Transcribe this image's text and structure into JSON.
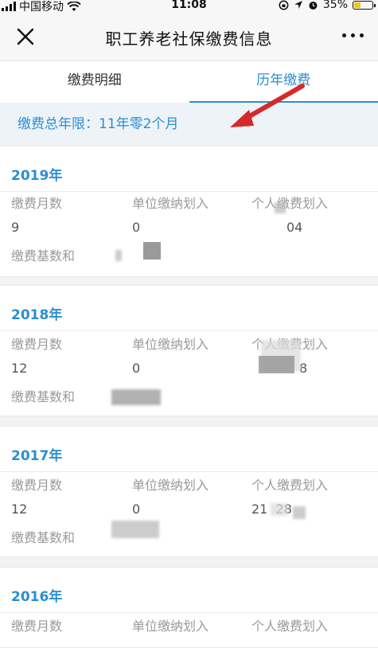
{
  "status_bar": {
    "carrier": "中国移动",
    "time": "11:08",
    "battery": "35%",
    "battery_level": 0.35
  },
  "nav": {
    "title": "职工养老社保缴费信息"
  },
  "tabs": [
    {
      "label": "缴费明细",
      "active": false
    },
    {
      "label": "历年缴费",
      "active": true
    }
  ],
  "summary": {
    "text": "缴费总年限：11年零2个月"
  },
  "labels": {
    "months": "缴费月数",
    "unit": "单位缴纳划入",
    "personal": "个人缴费划入",
    "base": "缴费基数和"
  },
  "records": [
    {
      "year": "2019年",
      "months": "9",
      "unit": "0",
      "personal": "04"
    },
    {
      "year": "2018年",
      "months": "12",
      "unit": "0",
      "personal": "8"
    },
    {
      "year": "2017年",
      "months": "12",
      "unit": "0",
      "personal": "21  28"
    },
    {
      "year": "2016年"
    }
  ],
  "colors": {
    "accent": "#2a8fd0",
    "arrow": "#d42a2a"
  }
}
